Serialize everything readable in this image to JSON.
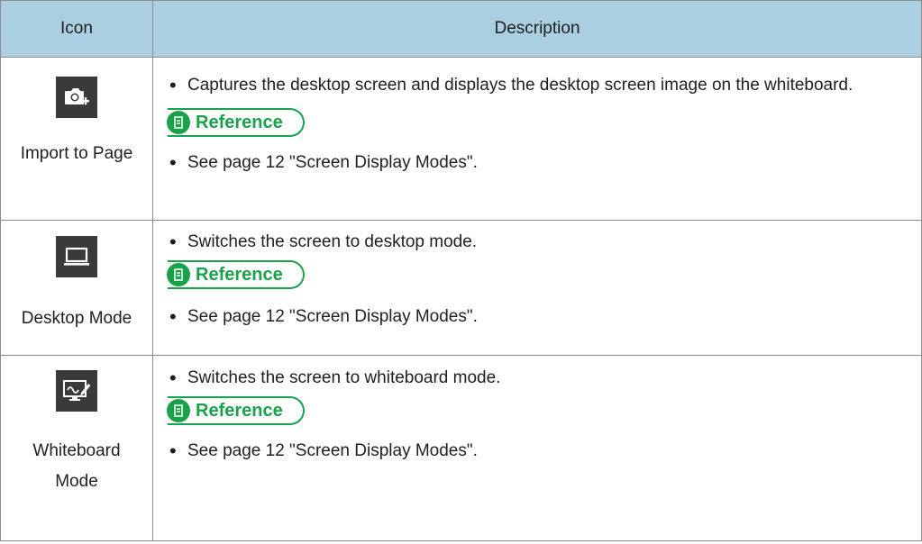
{
  "header": {
    "icon_col": "Icon",
    "desc_col": "Description"
  },
  "rows": [
    {
      "label": "Import to Page",
      "desc": "Captures the desktop screen and displays the desktop screen image on the whiteboard.",
      "ref_label": "Reference",
      "ref_text": "See page 12 \"Screen Display Modes\".",
      "icon": "camera-plus-icon"
    },
    {
      "label": "Desktop Mode",
      "desc": "Switches the screen to desktop mode.",
      "ref_label": "Reference",
      "ref_text": "See page 12 \"Screen Display Modes\".",
      "icon": "laptop-icon"
    },
    {
      "label_line1": "Whiteboard",
      "label_line2": "Mode",
      "desc": "Switches the screen to whiteboard mode.",
      "ref_label": "Reference",
      "ref_text": "See page 12 \"Screen Display Modes\".",
      "icon": "whiteboard-pen-icon"
    }
  ],
  "colors": {
    "header_bg": "#a9cfe1",
    "reference_green": "#1aa24a",
    "icon_bg": "#3a3a3a"
  }
}
